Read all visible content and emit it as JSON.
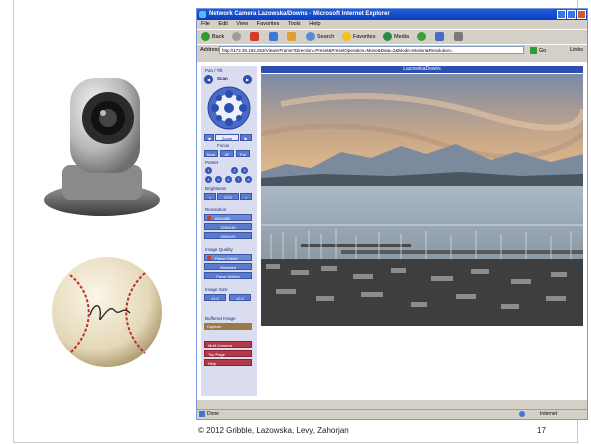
{
  "browser": {
    "title": "Network Camera Lazowska/Downs - Microsoft Internet Explorer",
    "menu": [
      "File",
      "Edit",
      "View",
      "Favorites",
      "Tools",
      "Help"
    ],
    "toolbar": {
      "back": "Back",
      "search": "Search",
      "favorites": "Favorites",
      "media": "Media"
    },
    "address_label": "Address",
    "address_value": "http://172.30.192.253/ViewerFrame?Direction=Preset&PresetOperation=Move&Data=2&Mode=Motion&Resolution=",
    "go_label": "Go",
    "links_label": "Links",
    "status_left": "Done",
    "status_right": "Internet"
  },
  "viewer": {
    "header": "LazowskaDowns"
  },
  "sidebar": {
    "pan_tilt_label": "Pan / Tilt",
    "scan_label": "Scan",
    "zoom_label": "Zoom",
    "zoom_value": "Zoom",
    "focus_label": "Focus",
    "focus_buttons": [
      "Near",
      "AF",
      "Far"
    ],
    "preset_label": "Preset",
    "preset_numbers": [
      "1",
      "2",
      "3",
      "4",
      "5",
      "6",
      "7",
      "8"
    ],
    "brightness_label": "Brightness",
    "brightness_buttons": [
      "<",
      "STD",
      ">"
    ],
    "resolution_label": "Resolution",
    "resolutions": [
      "640x480",
      "320x240",
      "160x120"
    ],
    "image_quality_label": "Image Quality",
    "qualities": [
      "Favor Clarity",
      "Standard",
      "Favor Motion"
    ],
    "image_size_label": "Image Size",
    "image_sizes": [
      "x1.0",
      "x2.0"
    ],
    "buffered_label": "Buffered Image",
    "capture_label": "Capture",
    "nav_buttons": [
      "Multi-Camera",
      "Top Page",
      "Help"
    ]
  },
  "footer": {
    "copyright": "© 2012 Gribble, Lazowska, Levy, Zahorjan",
    "page_number": "17"
  }
}
